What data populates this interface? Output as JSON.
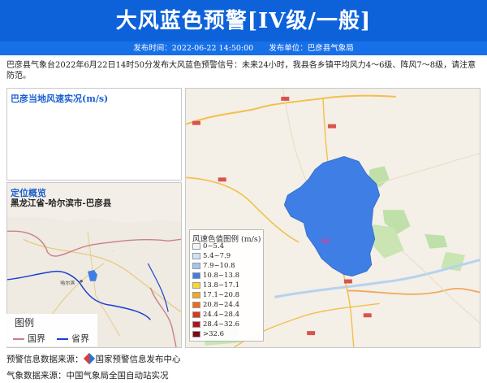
{
  "header": {
    "title": "大风蓝色预警[IV级/一般]",
    "publish_time": "发布时间：2022-06-22 14:50:00",
    "publish_unit": "发布单位：巴彦县气象局"
  },
  "description": "巴彦县气象台2022年6月22日14时50分发布大风蓝色预警信号：未来24小时，我县各乡镇平均风力4～6级、阵风7～8级，请注意防范。",
  "panels": {
    "wind_title": "巴彦当地风速实况(m/s)",
    "location_title": "定位概览",
    "location_path": "黑龙江省-哈尔滨市-巴彦县"
  },
  "mini_map": {
    "city_label": "哈尔滨",
    "legend_title": "图例",
    "items": [
      {
        "label": "国界",
        "color": "#c97f88"
      },
      {
        "label": "省界",
        "color": "#1a3fd1"
      }
    ]
  },
  "wind_legend": {
    "title": "风速色值图例 (m/s)",
    "rows": [
      {
        "label": "0~5.4",
        "color": "#f2f6fb"
      },
      {
        "label": "5.4~7.9",
        "color": "#cfe3f7"
      },
      {
        "label": "7.9~10.8",
        "color": "#9ec6f0"
      },
      {
        "label": "10.8~13.8",
        "color": "#3f7fe5"
      },
      {
        "label": "13.8~17.1",
        "color": "#f5d832"
      },
      {
        "label": "17.1~20.8",
        "color": "#f6a623"
      },
      {
        "label": "20.8~24.4",
        "color": "#ef6a1c"
      },
      {
        "label": "24.4~28.4",
        "color": "#d73a1c"
      },
      {
        "label": "28.4~32.6",
        "color": "#b3141b"
      },
      {
        "label": ">32.6",
        "color": "#7a0a14"
      }
    ]
  },
  "sources": {
    "warning": "预警信息数据来源：",
    "warning_org": "国家预警信息发布中心",
    "weather": "气象数据来源：中国气象局全国自动站实况"
  },
  "colors": {
    "banner": "#0d62d9",
    "accent": "#1a5fd0",
    "wind_area": "#3f7fe5"
  }
}
